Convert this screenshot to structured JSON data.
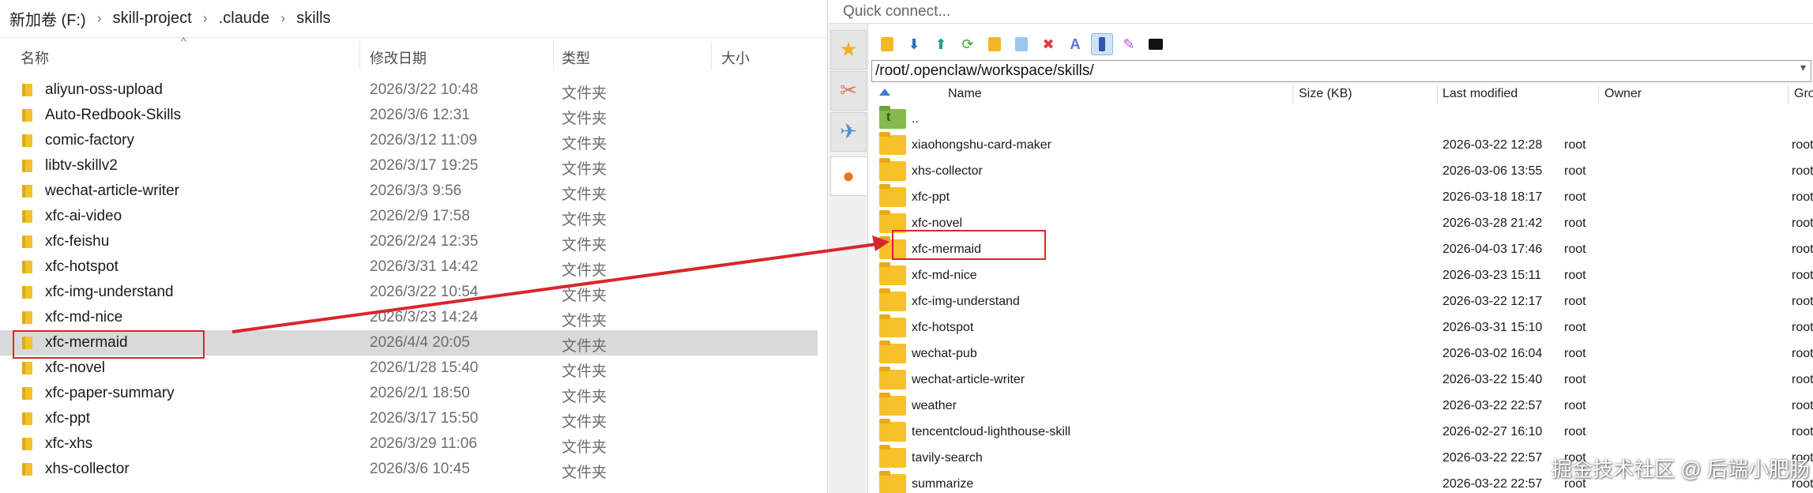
{
  "explorer": {
    "breadcrumb": [
      "新加卷 (F:)",
      "skill-project",
      ".claude",
      "skills"
    ],
    "columns": {
      "name": "名称",
      "date": "修改日期",
      "type": "类型",
      "size": "大小"
    },
    "rows": [
      {
        "name": "aliyun-oss-upload",
        "date": "2026/3/22 10:48",
        "type": "文件夹"
      },
      {
        "name": "Auto-Redbook-Skills",
        "date": "2026/3/6 12:31",
        "type": "文件夹"
      },
      {
        "name": "comic-factory",
        "date": "2026/3/12 11:09",
        "type": "文件夹"
      },
      {
        "name": "libtv-skillv2",
        "date": "2026/3/17 19:25",
        "type": "文件夹"
      },
      {
        "name": "wechat-article-writer",
        "date": "2026/3/3 9:56",
        "type": "文件夹"
      },
      {
        "name": "xfc-ai-video",
        "date": "2026/2/9 17:58",
        "type": "文件夹"
      },
      {
        "name": "xfc-feishu",
        "date": "2026/2/24 12:35",
        "type": "文件夹"
      },
      {
        "name": "xfc-hotspot",
        "date": "2026/3/31 14:42",
        "type": "文件夹"
      },
      {
        "name": "xfc-img-understand",
        "date": "2026/3/22 10:54",
        "type": "文件夹"
      },
      {
        "name": "xfc-md-nice",
        "date": "2026/3/23 14:24",
        "type": "文件夹"
      },
      {
        "name": "xfc-mermaid",
        "date": "2026/4/4 20:05",
        "type": "文件夹",
        "selected": true
      },
      {
        "name": "xfc-novel",
        "date": "2026/1/28 15:40",
        "type": "文件夹"
      },
      {
        "name": "xfc-paper-summary",
        "date": "2026/2/1 18:50",
        "type": "文件夹"
      },
      {
        "name": "xfc-ppt",
        "date": "2026/3/17 15:50",
        "type": "文件夹"
      },
      {
        "name": "xfc-xhs",
        "date": "2026/3/29 11:06",
        "type": "文件夹"
      },
      {
        "name": "xhs-collector",
        "date": "2026/3/6 10:45",
        "type": "文件夹"
      }
    ]
  },
  "scp": {
    "quick_connect_placeholder": "Quick connect...",
    "path": "/root/.openclaw/workspace/skills/",
    "columns": {
      "name": "Name",
      "size": "Size (KB)",
      "modified": "Last modified",
      "owner": "Owner",
      "group": "Group"
    },
    "parent": "..",
    "rows": [
      {
        "name": "xiaohongshu-card-maker",
        "modified": "2026-03-22 12:28",
        "owner": "root",
        "group": "root"
      },
      {
        "name": "xhs-collector",
        "modified": "2026-03-06 13:55",
        "owner": "root",
        "group": "root"
      },
      {
        "name": "xfc-ppt",
        "modified": "2026-03-18 18:17",
        "owner": "root",
        "group": "root"
      },
      {
        "name": "xfc-novel",
        "modified": "2026-03-28 21:42",
        "owner": "root",
        "group": "root"
      },
      {
        "name": "xfc-mermaid",
        "modified": "2026-04-03 17:46",
        "owner": "root",
        "group": "root",
        "highlighted": true
      },
      {
        "name": "xfc-md-nice",
        "modified": "2026-03-23 15:11",
        "owner": "root",
        "group": "root"
      },
      {
        "name": "xfc-img-understand",
        "modified": "2026-03-22 12:17",
        "owner": "root",
        "group": "root"
      },
      {
        "name": "xfc-hotspot",
        "modified": "2026-03-31 15:10",
        "owner": "root",
        "group": "root"
      },
      {
        "name": "wechat-pub",
        "modified": "2026-03-02 16:04",
        "owner": "root",
        "group": "root"
      },
      {
        "name": "wechat-article-writer",
        "modified": "2026-03-22 15:40",
        "owner": "root",
        "group": "root"
      },
      {
        "name": "weather",
        "modified": "2026-03-22 22:57",
        "owner": "root",
        "group": "root"
      },
      {
        "name": "tencentcloud-lighthouse-skill",
        "modified": "2026-02-27 16:10",
        "owner": "root",
        "group": "root"
      },
      {
        "name": "tavily-search",
        "modified": "2026-03-22 22:57",
        "owner": "root",
        "group": "root"
      },
      {
        "name": "summarize",
        "modified": "2026-03-22 22:57",
        "owner": "root",
        "group": "root"
      }
    ],
    "toolbar_icons": [
      "parent-folder-icon",
      "download-icon",
      "upload-icon",
      "refresh-icon",
      "new-folder-icon",
      "new-file-icon",
      "delete-icon",
      "rename-icon",
      "properties-icon",
      "find-icon",
      "terminal-icon"
    ],
    "sidebar_icons": [
      "favorites-star-icon",
      "tools-icon",
      "send-icon",
      "sites-icon"
    ]
  },
  "watermark": "掘金技术社区 @ 后端小肥肠",
  "colors": {
    "highlight": "#d9262b",
    "folder": "#f7c12a",
    "selection": "#d9d9d9"
  }
}
